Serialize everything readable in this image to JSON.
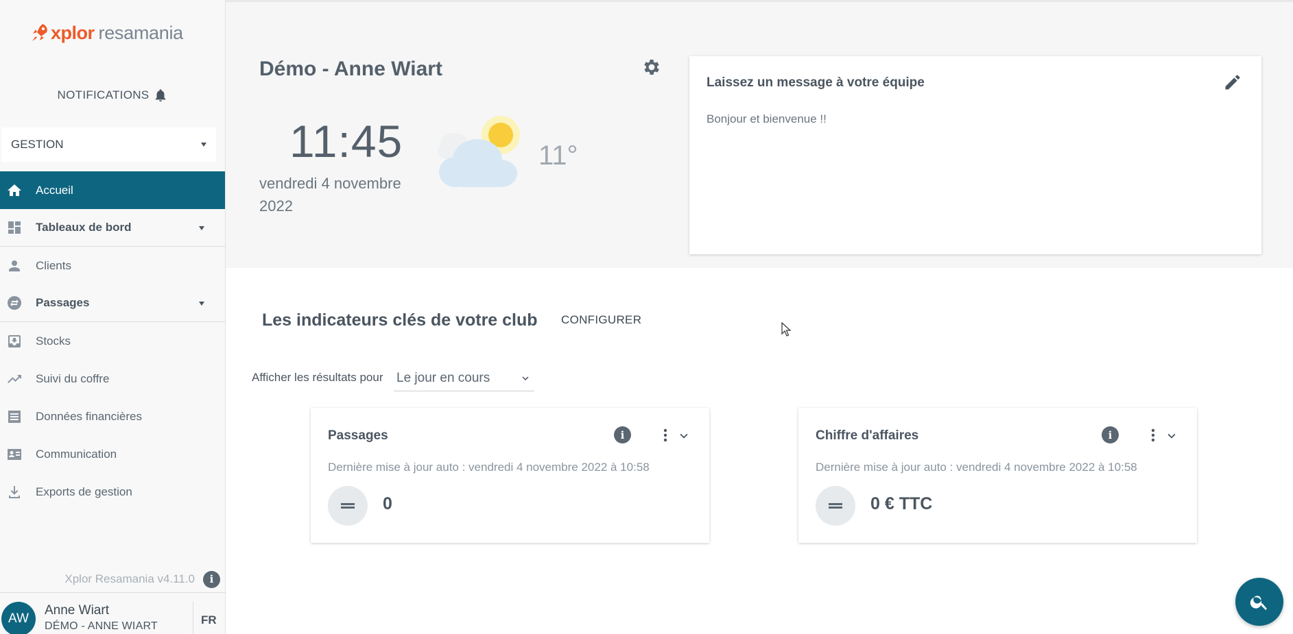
{
  "brand": {
    "name_primary": "xplor",
    "name_secondary": "resamania",
    "accent": "#ee5a2a",
    "primary": "#0e6580"
  },
  "sidebar": {
    "notifications_label": "NOTIFICATIONS",
    "section_select": "GESTION",
    "items": [
      {
        "label": "Accueil",
        "icon": "home-icon",
        "active": true
      },
      {
        "label": "Tableaux de bord",
        "icon": "dashboard-icon",
        "expandable": true
      },
      {
        "label": "Clients",
        "icon": "person-icon"
      },
      {
        "label": "Passages",
        "icon": "swap-icon",
        "expandable": true
      },
      {
        "label": "Stocks",
        "icon": "inbox-download-icon"
      },
      {
        "label": "Suivi du coffre",
        "icon": "trending-up-icon"
      },
      {
        "label": "Données financières",
        "icon": "receipt-icon"
      },
      {
        "label": "Communication",
        "icon": "contact-card-icon"
      },
      {
        "label": "Exports de gestion",
        "icon": "download-icon"
      }
    ],
    "version": "Xplor Resamania v4.11.0",
    "user": {
      "initials": "AW",
      "name": "Anne Wiart",
      "club": "DÉMO - ANNE WIART",
      "lang": "FR"
    }
  },
  "header": {
    "club_title": "Démo - Anne Wiart",
    "time": "11:45",
    "date": "vendredi 4 novembre 2022",
    "temperature": "11°",
    "weather_icon": "partly-cloudy-icon"
  },
  "message_card": {
    "title": "Laissez un message à votre équipe",
    "text": "Bonjour et bienvenue !!"
  },
  "kpi": {
    "title": "Les indicateurs clés de votre club",
    "configure_label": "CONFIGURER",
    "filter_label": "Afficher les résultats pour",
    "filter_value": "Le jour en cours",
    "cards": [
      {
        "title": "Passages",
        "updated": "Dernière mise à jour auto : vendredi 4 novembre 2022 à 10:58",
        "value": "0"
      },
      {
        "title": "Chiffre d'affaires",
        "updated": "Dernière mise à jour auto : vendredi 4 novembre 2022 à 10:58",
        "value": "0 € TTC"
      }
    ]
  }
}
